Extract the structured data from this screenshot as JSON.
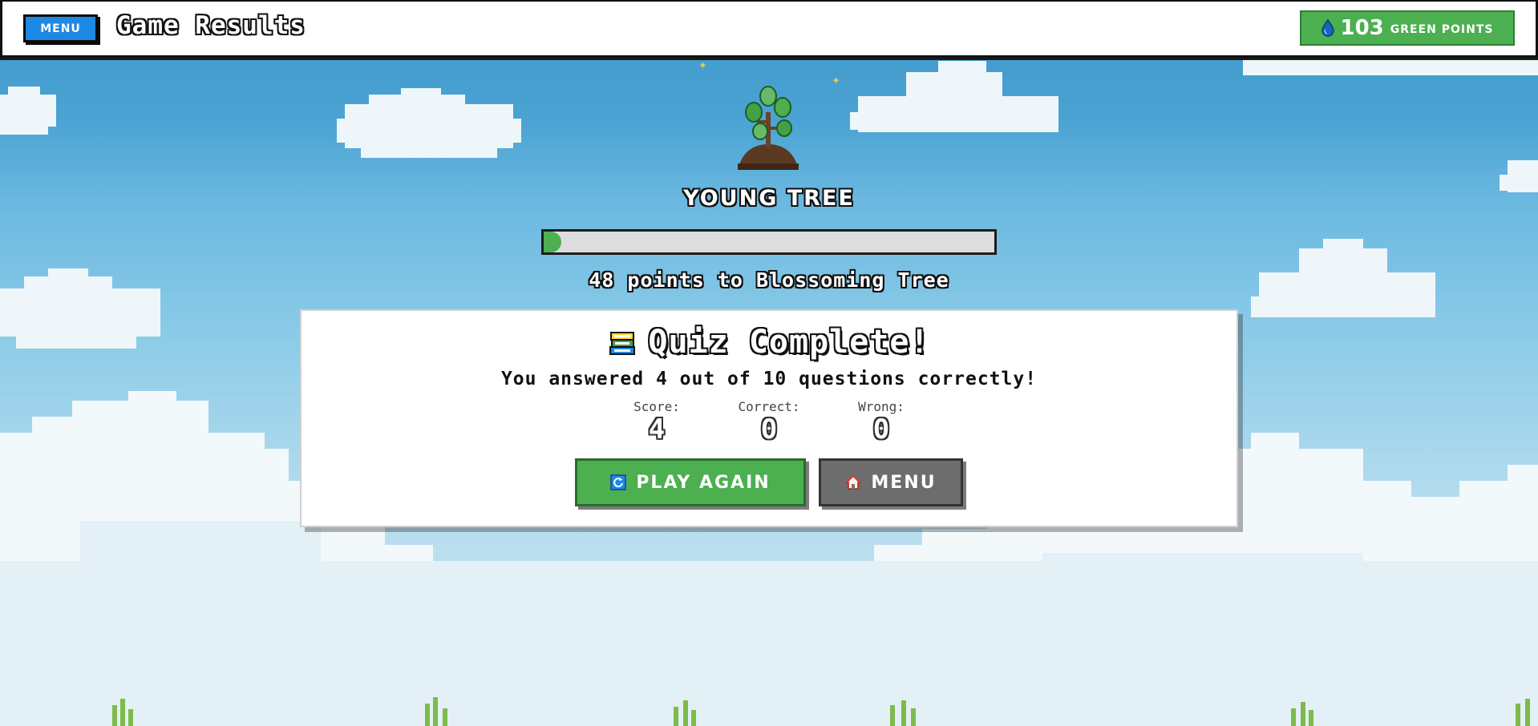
{
  "header": {
    "menu_label": "MENU",
    "title": "Game Results",
    "points_value": "103",
    "points_label": "GREEN POINTS",
    "points_icon": "water-drop-icon"
  },
  "tree": {
    "stage": "YOUNG TREE",
    "progress_percent": 4,
    "next_text": "48 points to Blossoming Tree",
    "icon": "sapling-tree-icon"
  },
  "card": {
    "title_icon": "books-icon",
    "title": "Quiz Complete!",
    "summary": "You answered 4 out of 10 questions correctly!",
    "stats": [
      {
        "label": "Score:",
        "value": "4"
      },
      {
        "label": "Correct:",
        "value": "0"
      },
      {
        "label": "Wrong:",
        "value": "0"
      }
    ],
    "play_again_label": "PLAY AGAIN",
    "menu_label": "MENU"
  },
  "colors": {
    "accent_blue": "#1e88e5",
    "green": "#4caf50",
    "gray_button": "#6d6d6d"
  }
}
